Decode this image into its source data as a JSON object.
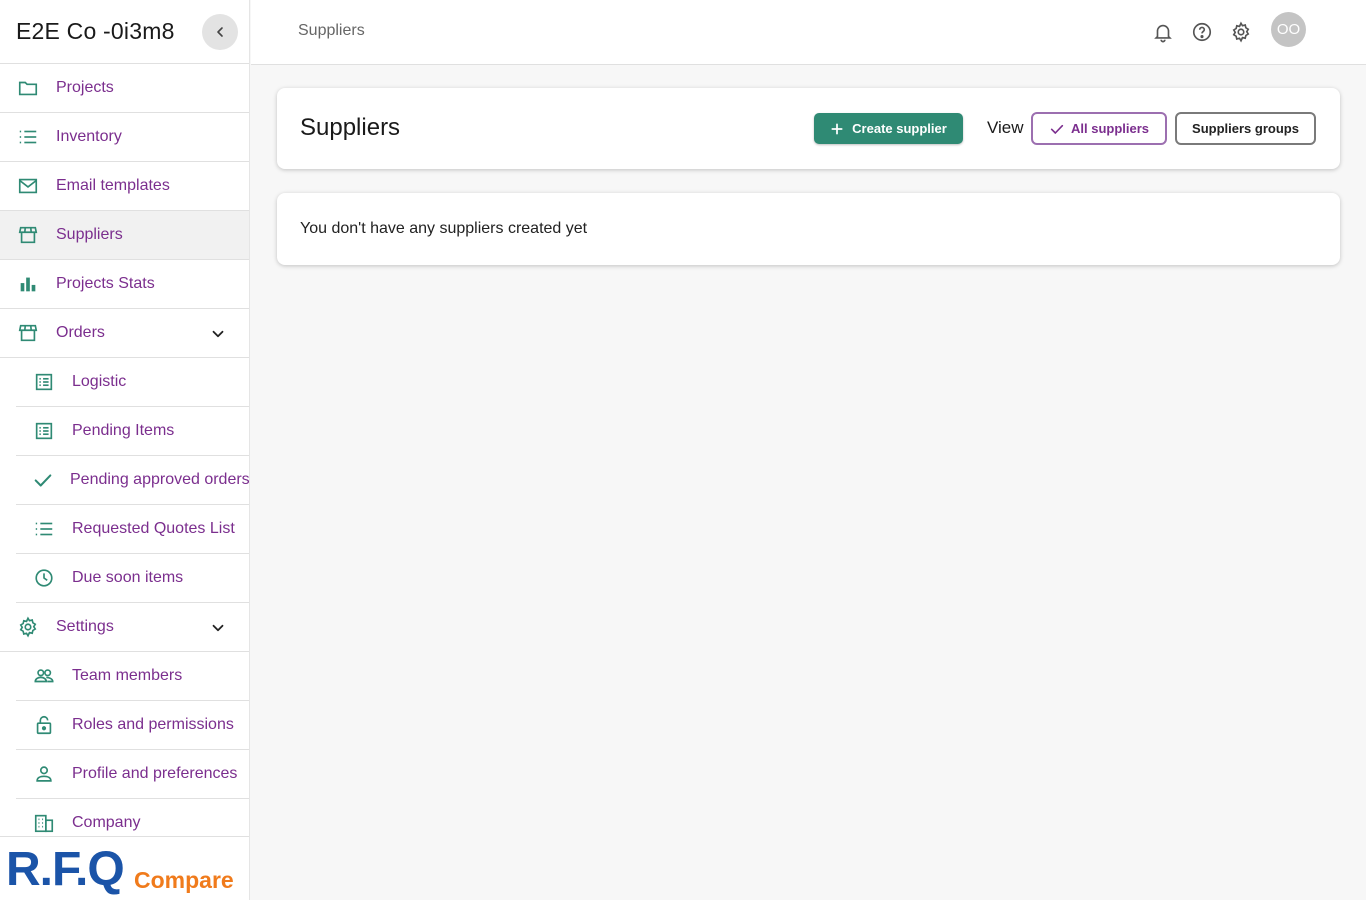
{
  "sidebar": {
    "org_name": "E2E Co -0i3m8",
    "items": [
      {
        "label": "Projects",
        "icon": "folder-icon"
      },
      {
        "label": "Inventory",
        "icon": "list-icon"
      },
      {
        "label": "Email templates",
        "icon": "mail-icon"
      },
      {
        "label": "Suppliers",
        "icon": "store-icon",
        "active": true
      },
      {
        "label": "Projects Stats",
        "icon": "bar-chart-icon"
      },
      {
        "label": "Orders",
        "icon": "store-icon",
        "expanded": true
      },
      {
        "label": "Logistic",
        "icon": "receipt-icon"
      },
      {
        "label": "Pending Items",
        "icon": "receipt-icon"
      },
      {
        "label": "Pending approved orders",
        "icon": "check-icon"
      },
      {
        "label": "Requested Quotes List",
        "icon": "list-icon"
      },
      {
        "label": "Due soon items",
        "icon": "clock-icon"
      },
      {
        "label": "Settings",
        "icon": "gear-icon",
        "expanded": true
      },
      {
        "label": "Team members",
        "icon": "people-icon"
      },
      {
        "label": "Roles and permissions",
        "icon": "lock-icon"
      },
      {
        "label": "Profile and preferences",
        "icon": "person-icon"
      },
      {
        "label": "Company",
        "icon": "building-icon"
      }
    ],
    "logo": {
      "text_main": "R.F.Q",
      "text_sub": "Compare"
    }
  },
  "header": {
    "breadcrumb": "Suppliers",
    "avatar_initials": "OO"
  },
  "main": {
    "title": "Suppliers",
    "create_button": "Create supplier",
    "view_label": "View",
    "view_options": [
      "All suppliers",
      "Suppliers groups"
    ],
    "selected_view": "All suppliers",
    "empty_message": "You don't have any suppliers created yet"
  },
  "colors": {
    "accent_green": "#2f8a74",
    "link_purple": "#7b2e8e",
    "logo_blue": "#1b54a8",
    "logo_orange": "#f07b1c"
  }
}
